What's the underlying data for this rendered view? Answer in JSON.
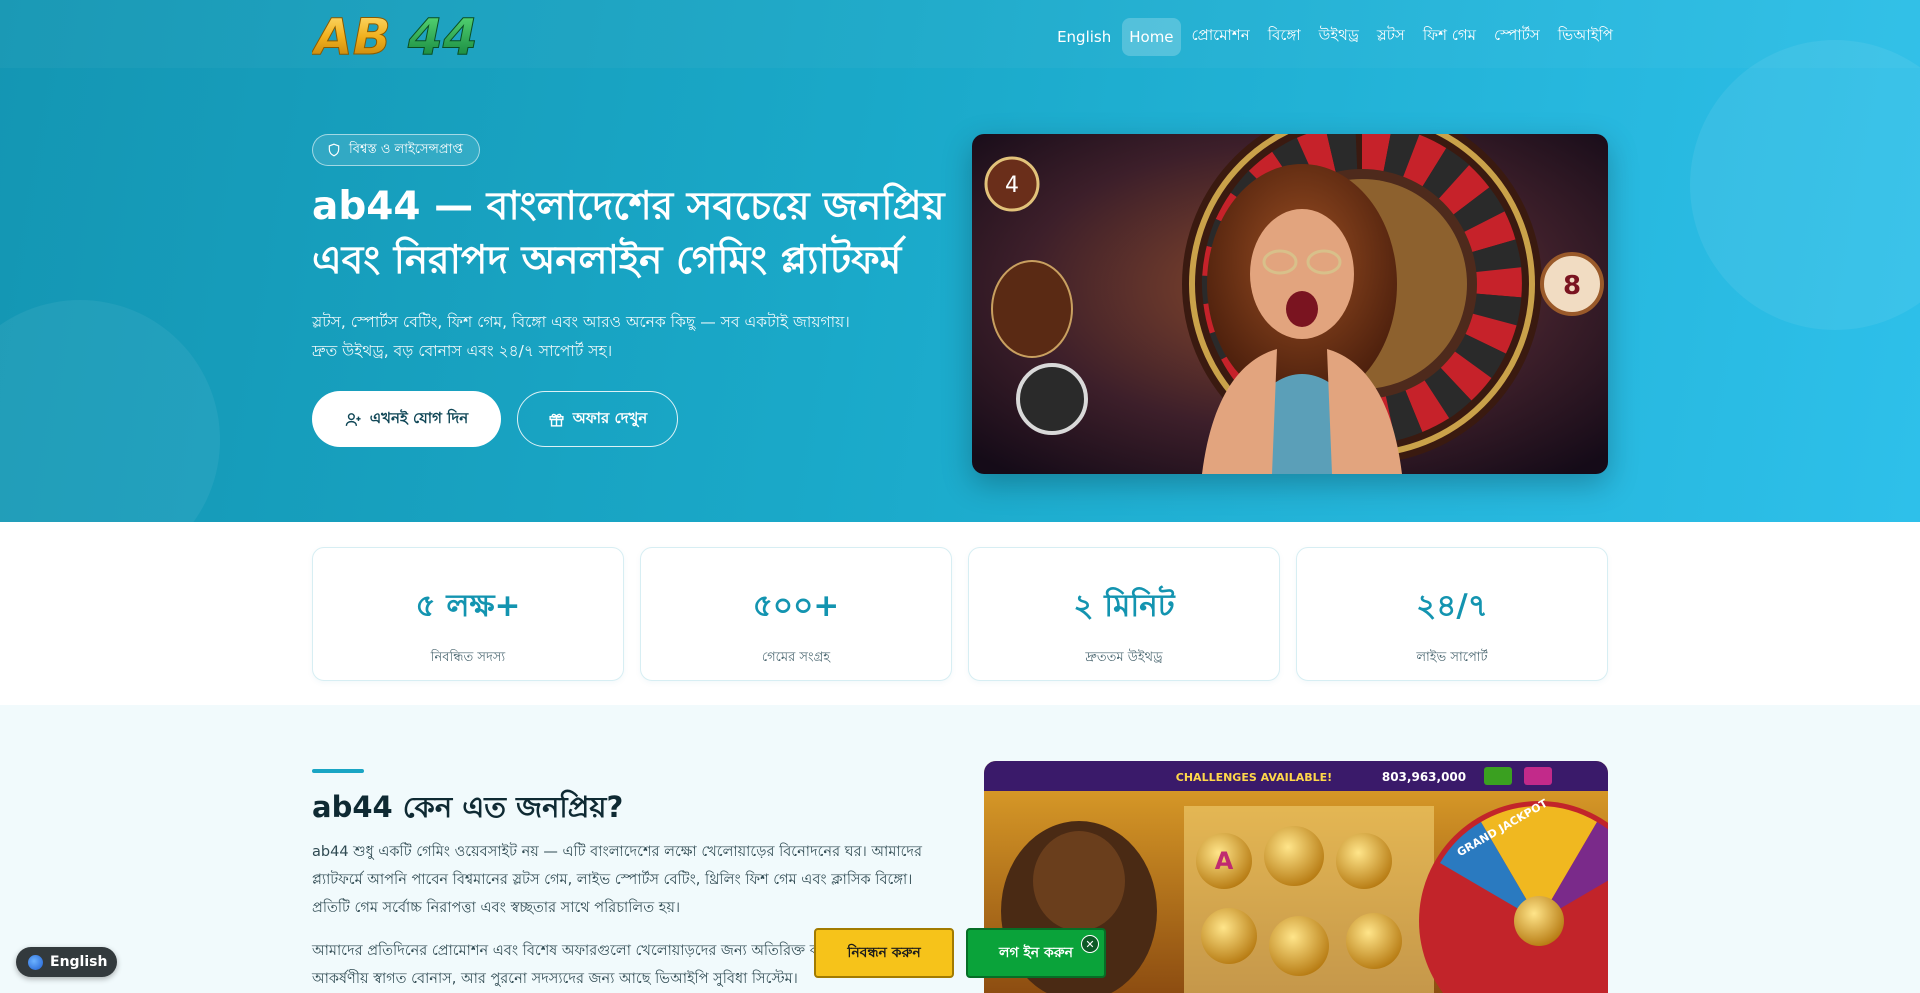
{
  "brand": {
    "logo_text": "AB44"
  },
  "nav": {
    "items": [
      {
        "label": "English",
        "active": false
      },
      {
        "label": "Home",
        "active": true
      },
      {
        "label": "প্রোমোশন",
        "active": false
      },
      {
        "label": "বিঙ্গো",
        "active": false
      },
      {
        "label": "উইথড্র",
        "active": false
      },
      {
        "label": "স্লটস",
        "active": false
      },
      {
        "label": "ফিশ গেম",
        "active": false
      },
      {
        "label": "স্পোর্টস",
        "active": false
      },
      {
        "label": "ভিআইপি",
        "active": false
      }
    ]
  },
  "hero": {
    "badge": "বিশ্বস্ত ও লাইসেন্সপ্রাপ্ত",
    "title": "ab44 — বাংলাদেশের সবচেয়ে জনপ্রিয় এবং নিরাপদ অনলাইন গেমিং প্ল্যাটফর্ম",
    "subtitle_line1": "স্লটস, স্পোর্টস বেটিং, ফিশ গেম, বিঙ্গো এবং আরও অনেক কিছু — সব একটাই জায়গায়।",
    "subtitle_line2": "দ্রুত উইথড্র, বড় বোনাস এবং ২৪/৭ সাপোর্ট সহ।",
    "join_label": "এখনই যোগ দিন",
    "offer_label": "অফার দেখুন"
  },
  "stats": [
    {
      "value": "৫ লক্ষ+",
      "label": "নিবন্ধিত সদস্য"
    },
    {
      "value": "৫০০+",
      "label": "গেমের সংগ্রহ"
    },
    {
      "value": "২ মিনিট",
      "label": "দ্রুততম উইথড্র"
    },
    {
      "value": "২৪/৭",
      "label": "লাইভ সাপোর্ট"
    }
  ],
  "why": {
    "title": "ab44 কেন এত জনপ্রিয়?",
    "p1": "ab44 শুধু একটি গেমিং ওয়েবসাইট নয় — এটি বাংলাদেশের লক্ষো খেলোয়াড়ের বিনোদনের ঘর। আমাদের প্ল্যাটফর্মে আপনি পাবেন বিশ্বমানের স্লটস গেম, লাইভ স্পোর্টস বেটিং, থ্রিলিং ফিশ গেম এবং ক্লাসিক বিঙ্গো। প্রতিটি গেম সর্বোচ্চ নিরাপত্তা এবং স্বচ্ছতার সাথে পরিচালিত হয়।",
    "p2": "আমাদের প্রতিদিনের প্রোমোশন এবং বিশেষ অফারগুলো খেলোয়াড়দের জন্য অতিরিক্ত করে। নতুন সদস্যরা পান আকর্ষণীয় স্বাগত বোনাস, আর পুরনো সদস্যদের জন্য আছে ভিআইপি সুবিধা সিস্টেম।",
    "game_banner_text": "CHALLENGES AVAILABLE!",
    "game_balance": "803,963,000",
    "game_wheel_text": "GRAND JACKPOT"
  },
  "floating": {
    "language_label": "English",
    "register_label": "নিবন্ধন করুন",
    "login_label": "লগ ইন করুন",
    "close_symbol": "✕"
  },
  "colors": {
    "accent": "#1394b0",
    "hero_start": "#1496b3",
    "hero_end": "#2ec0ea",
    "register_yellow": "#f6c31a",
    "login_green": "#0aa33a"
  }
}
